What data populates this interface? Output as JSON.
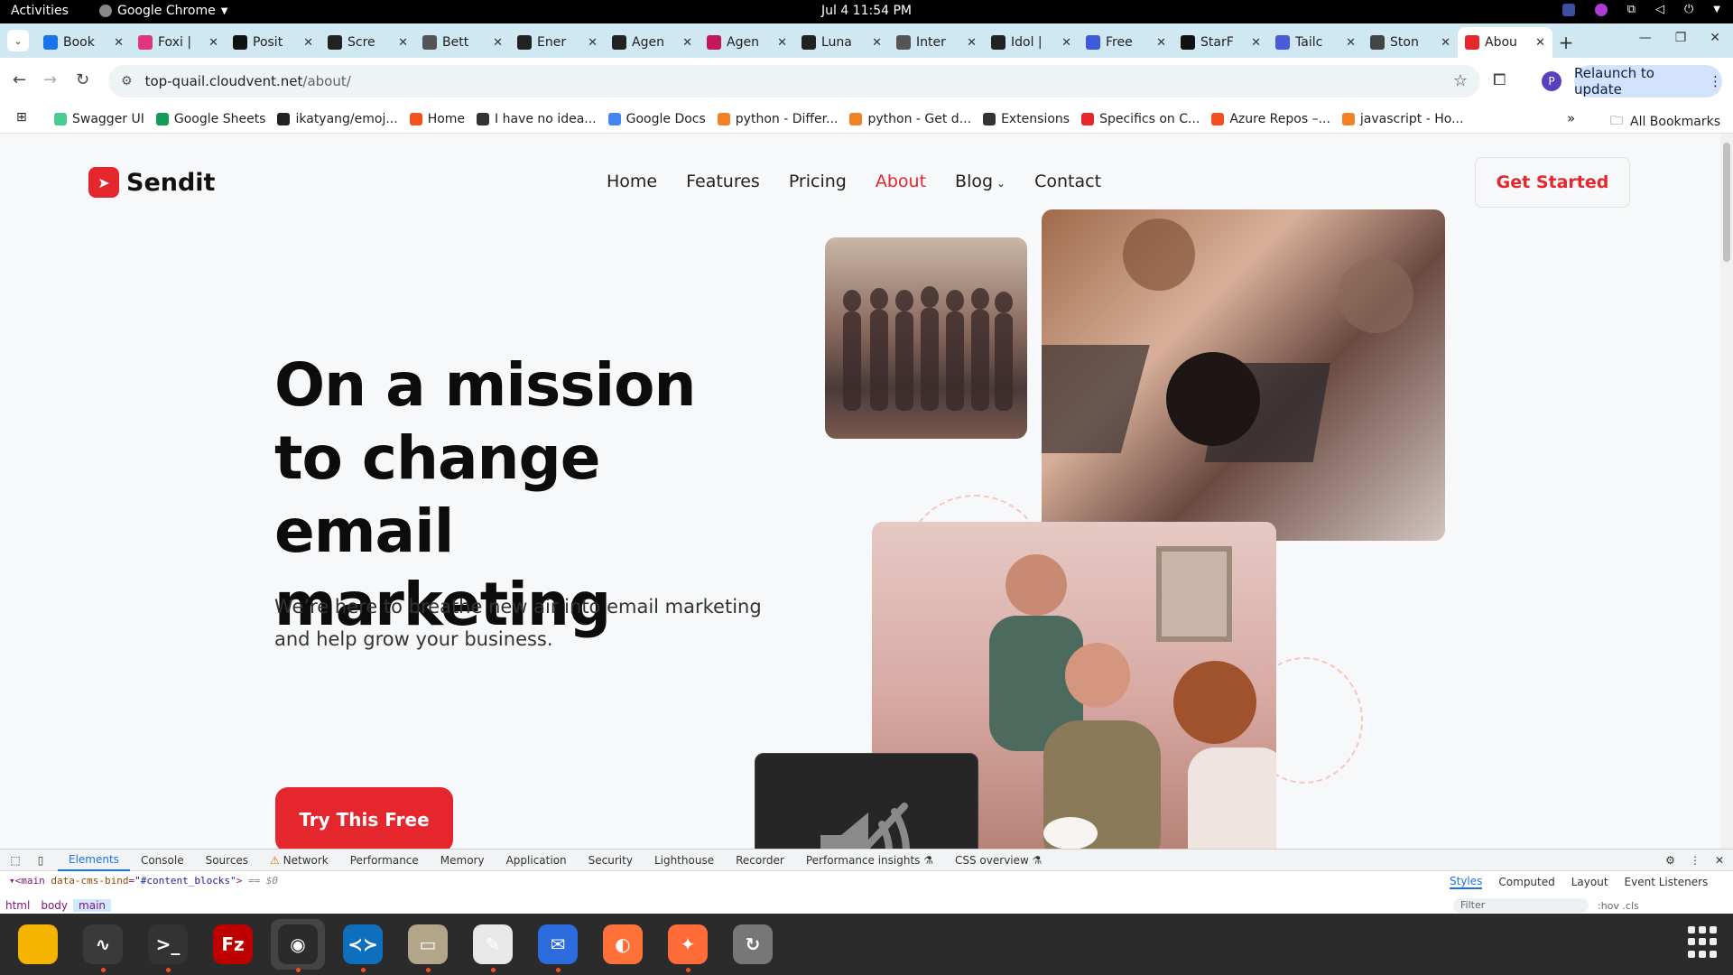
{
  "system_bar": {
    "activities": "Activities",
    "app_name": "Google Chrome",
    "clock": "Jul 4  11:54 PM"
  },
  "browser": {
    "tabs": [
      {
        "title": "Book",
        "icon": "star-icon",
        "color": "#1a73e8"
      },
      {
        "title": "Foxi |",
        "icon": "fox-icon",
        "color": "#e0357a"
      },
      {
        "title": "Posit",
        "icon": "position-icon",
        "color": "#111111"
      },
      {
        "title": "Scre",
        "icon": "terminal-icon",
        "color": "#222222"
      },
      {
        "title": "Bett",
        "icon": "globe-icon",
        "color": "#555555"
      },
      {
        "title": "Ener",
        "icon": "agent-icon",
        "color": "#222222"
      },
      {
        "title": "Agen",
        "icon": "agent-icon",
        "color": "#222222"
      },
      {
        "title": "Agen",
        "icon": "agent-alt-icon",
        "color": "#c2185b"
      },
      {
        "title": "Luna",
        "icon": "agent-icon",
        "color": "#222222"
      },
      {
        "title": "Inter",
        "icon": "globe-icon",
        "color": "#555555"
      },
      {
        "title": "Idol |",
        "icon": "agent-icon",
        "color": "#222222"
      },
      {
        "title": "Free",
        "icon": "circle-icon",
        "color": "#3b5bdb"
      },
      {
        "title": "StarF",
        "icon": "starfleet-icon",
        "color": "#111111"
      },
      {
        "title": "Tailc",
        "icon": "tailwind-icon",
        "color": "#4b5bd7"
      },
      {
        "title": "Ston",
        "icon": "stone-icon",
        "color": "#444444"
      },
      {
        "title": "Abou",
        "icon": "sendit-icon",
        "color": "#e5262d",
        "active": true
      }
    ],
    "url_host": "top-quail.cloudvent.net",
    "url_path": "/about/",
    "relaunch_label": "Relaunch to update",
    "profile_initial": "P",
    "bookmarks": [
      {
        "label": "Swagger UI",
        "color": "#49cc90"
      },
      {
        "label": "Google Sheets",
        "color": "#0f9d58"
      },
      {
        "label": "ikatyang/emoj...",
        "color": "#222222"
      },
      {
        "label": "Home",
        "color": "#f4511e"
      },
      {
        "label": "I have no idea...",
        "color": "#333333"
      },
      {
        "label": "Google Docs",
        "color": "#4285f4"
      },
      {
        "label": "python - Differ...",
        "color": "#f48024"
      },
      {
        "label": "python - Get d...",
        "color": "#f48024"
      },
      {
        "label": "Extensions",
        "color": "#333333"
      },
      {
        "label": "Specifics on C...",
        "color": "#e5262d"
      },
      {
        "label": "Azure Repos –...",
        "color": "#f25022"
      },
      {
        "label": "javascript - Ho...",
        "color": "#f48024"
      }
    ],
    "all_bookmarks": "All Bookmarks"
  },
  "site": {
    "brand": "Sendit",
    "brand_color": "#e5262d",
    "nav": [
      {
        "label": "Home"
      },
      {
        "label": "Features"
      },
      {
        "label": "Pricing"
      },
      {
        "label": "About",
        "active": true
      },
      {
        "label": "Blog",
        "dropdown": true
      },
      {
        "label": "Contact"
      }
    ],
    "header_cta": "Get Started",
    "hero_title": "On a mission to change email marketing",
    "hero_subtitle": "We’re here to breathe new air into email marketing and help grow your business.",
    "hero_cta": "Try This Free"
  },
  "osd": {
    "icon": "speaker-muted-icon"
  },
  "devtools": {
    "tabs": [
      "Elements",
      "Console",
      "Sources",
      "Network",
      "Performance",
      "Memory",
      "Application",
      "Security",
      "Lighthouse",
      "Recorder",
      "Performance insights",
      "CSS overview"
    ],
    "active_tab": "Elements",
    "dom_tag": "main",
    "dom_attr": "data-cms-bind",
    "dom_value": "\"#content_blocks\"",
    "dom_suffix": "== $0",
    "side_tabs": [
      "Styles",
      "Computed",
      "Layout",
      "Event Listeners"
    ],
    "crumbs": [
      "html",
      "body",
      "main"
    ],
    "filter_placeholder": "Filter",
    "filter_tools": ":hov  .cls"
  },
  "dock": [
    {
      "name": "notes",
      "color": "#f5b400",
      "label": "",
      "running": false
    },
    {
      "name": "system-monitor",
      "color": "#3a3a3a",
      "label": "∿",
      "running": true
    },
    {
      "name": "terminal",
      "color": "#333333",
      "label": ">_",
      "running": true
    },
    {
      "name": "filezilla",
      "color": "#bf0000",
      "label": "Fz",
      "running": false
    },
    {
      "name": "chrome",
      "color": "#2b2b2b",
      "label": "◉",
      "running": true,
      "focused": true
    },
    {
      "name": "vscode",
      "color": "#0e6fbf",
      "label": "≺≻",
      "running": true
    },
    {
      "name": "files",
      "color": "#b3a58a",
      "label": "▭",
      "running": true
    },
    {
      "name": "text-editor",
      "color": "#e8e8e8",
      "label": "✎",
      "running": true
    },
    {
      "name": "thunderbird",
      "color": "#2d6cdf",
      "label": "✉",
      "running": true
    },
    {
      "name": "firefox",
      "color": "#ff7139",
      "label": "◐",
      "running": false
    },
    {
      "name": "postman",
      "color": "#ff6c37",
      "label": "✦",
      "running": true
    },
    {
      "name": "updater",
      "color": "#777777",
      "label": "↻",
      "running": false
    }
  ]
}
